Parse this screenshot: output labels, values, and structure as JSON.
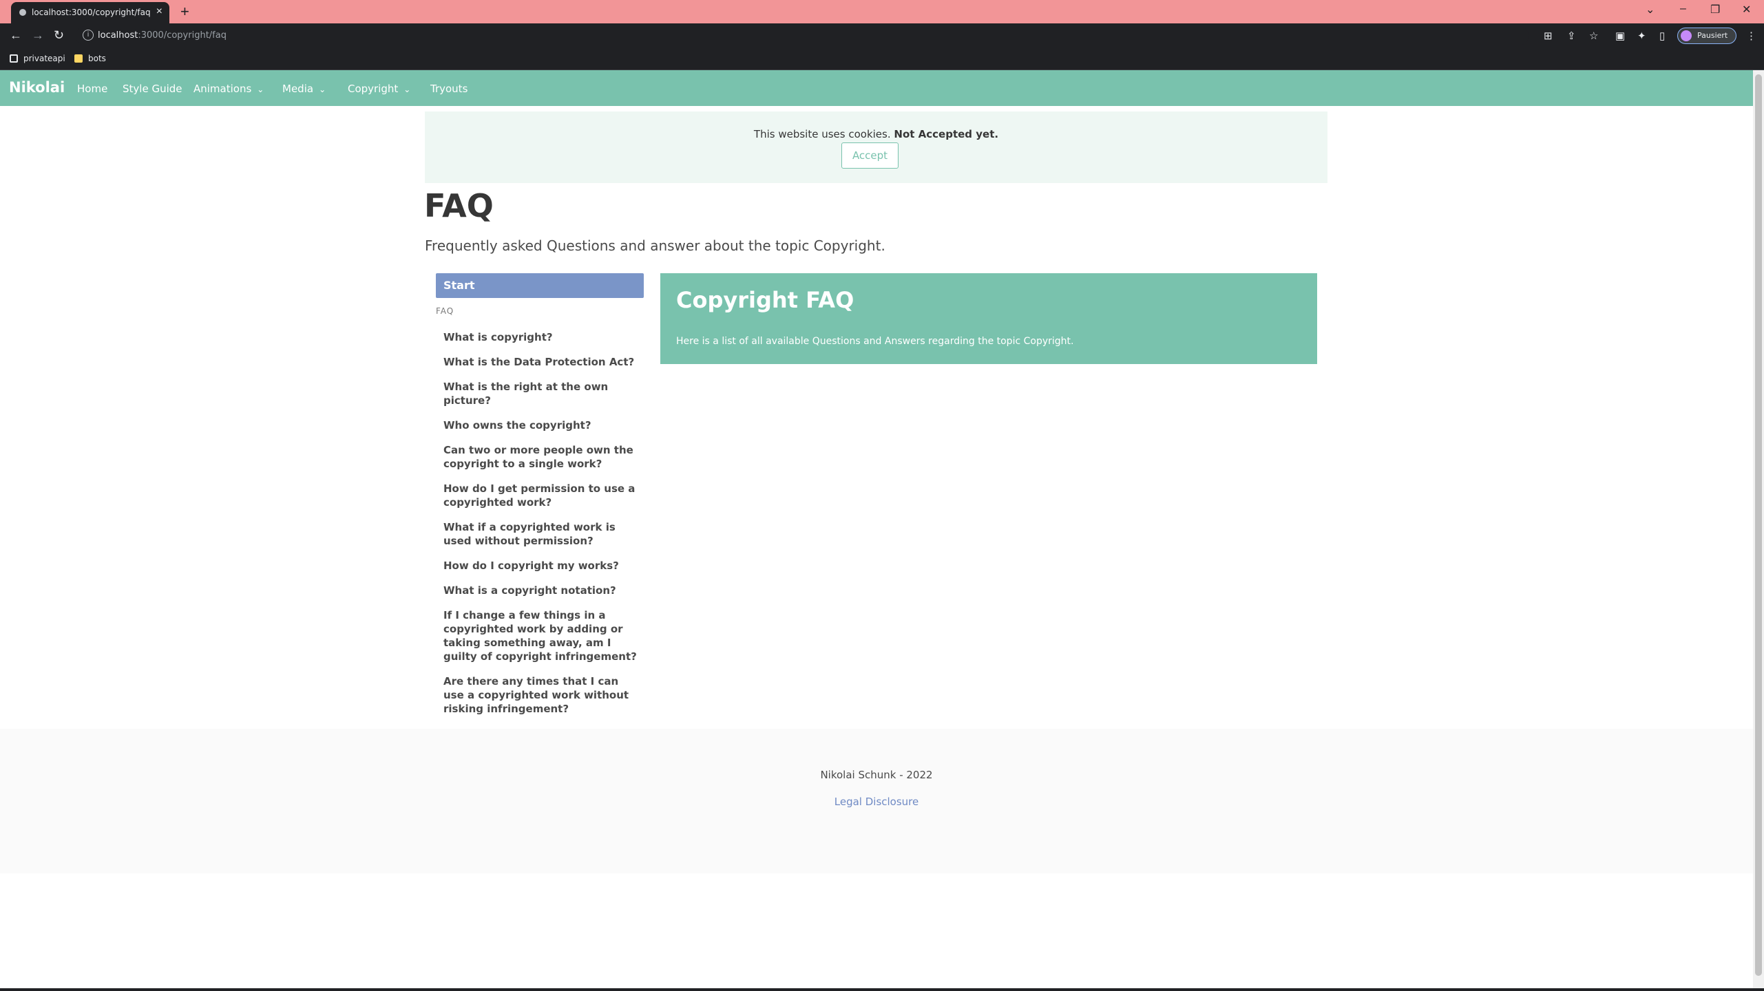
{
  "browser": {
    "tab_title": "localhost:3000/copyright/faq",
    "tab_close": "×",
    "new_tab": "+",
    "url_host": "localhost",
    "url_path": ":3000/copyright/faq",
    "profile_label": "Pausiert",
    "bookmarks": [
      {
        "label": "privateapi",
        "icon": "bookmark-site-icon"
      },
      {
        "label": "bots",
        "icon": "folder-icon"
      }
    ]
  },
  "navbar": {
    "brand": "Nikolai",
    "items": [
      {
        "label": "Home",
        "dropdown": false
      },
      {
        "label": "Style Guide",
        "dropdown": false
      },
      {
        "label": "Animations",
        "dropdown": true
      },
      {
        "label": "Media",
        "dropdown": true
      },
      {
        "label": "Copyright",
        "dropdown": true
      },
      {
        "label": "Tryouts",
        "dropdown": false
      }
    ]
  },
  "cookie": {
    "text": "This website uses cookies.",
    "status": "Not Accepted yet.",
    "button": "Accept"
  },
  "page": {
    "title": "FAQ",
    "subtitle": "Frequently asked Questions and answer about the topic Copyright."
  },
  "menu": {
    "active": "Start",
    "label": "FAQ",
    "items": [
      "What is copyright?",
      "What is the Data Protection Act?",
      "What is the right at the own picture?",
      "Who owns the copyright?",
      "Can two or more people own the copyright to a single work?",
      "How do I get permission to use a copyrighted work?",
      "What if a copyrighted work is used without permission?",
      "How do I copyright my works?",
      "What is a copyright notation?",
      "If I change a few things in a copyrighted work by adding or taking something away, am I guilty of copyright infringement?",
      "Are there any times that I can use a copyrighted work without risking infringement?"
    ]
  },
  "hero": {
    "title": "Copyright FAQ",
    "text": "Here is a list of all available Questions and Answers regarding the topic Copyright."
  },
  "footer": {
    "text": "Nikolai Schunk - 2022",
    "link": "Legal Disclosure"
  },
  "colors": {
    "navbar": "#79c2ad",
    "active_menu": "#7a95c8",
    "tab_strip": "#f29597",
    "link": "#6f8ac4"
  }
}
